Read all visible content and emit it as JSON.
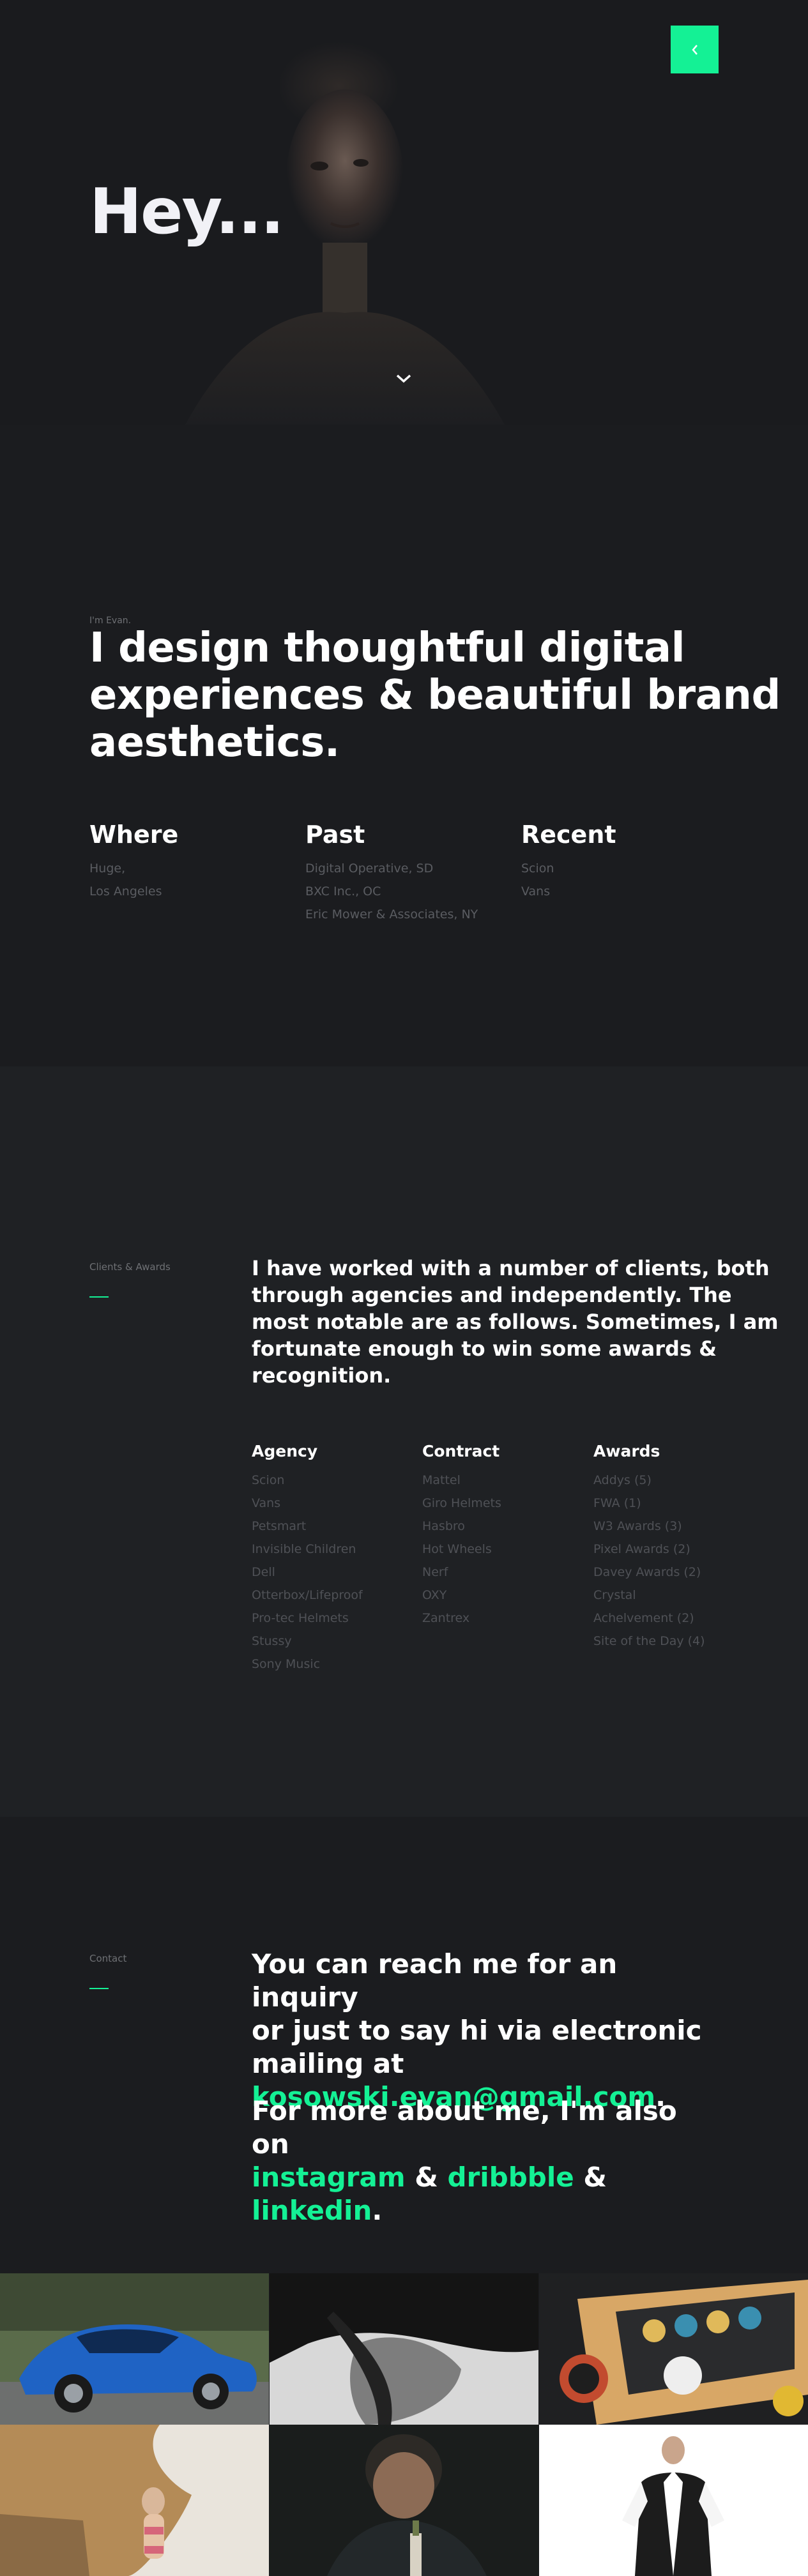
{
  "hero": {
    "title": "Hey..."
  },
  "about": {
    "eyebrow": "I'm Evan.",
    "headline_lines": [
      "I design thoughtful digital",
      "experiences & beautiful brand",
      "aesthetics."
    ],
    "where": {
      "heading": "Where",
      "items": [
        "Huge,",
        "Los Angeles"
      ]
    },
    "past": {
      "heading": "Past",
      "items": [
        "Digital Operative, SD",
        "BXC Inc., OC",
        "Eric Mower & Associates, NY"
      ]
    },
    "recent": {
      "heading": "Recent",
      "items": [
        "Scion",
        "Vans"
      ]
    }
  },
  "clients": {
    "label": "Clients & Awards",
    "paragraph_lines": [
      "I have worked with a number of clients, both",
      "through agencies and independently. The",
      "most notable are as follows. Sometimes, I am",
      "fortunate enough to win some awards &",
      "recognition."
    ],
    "agency": {
      "heading": "Agency",
      "items": [
        "Scion",
        "Vans",
        "Petsmart",
        "Invisible Children",
        "Dell",
        "Otterbox/Lifeproof",
        "Pro-tec Helmets",
        "Stussy",
        "Sony Music"
      ]
    },
    "contract": {
      "heading": "Contract",
      "items": [
        "Mattel",
        "Giro Helmets",
        "Hasbro",
        "Hot Wheels",
        "Nerf",
        "OXY",
        "Zantrex"
      ]
    },
    "awards": {
      "heading": "Awards",
      "items": [
        "Addys (5)",
        "FWA (1)",
        "W3 Awards (3)",
        "Pixel Awards (2)",
        "Davey Awards (2)",
        "Crystal",
        "Achelvement (2)",
        "Site of the Day (4)"
      ]
    }
  },
  "contact": {
    "label": "Contact",
    "line1": "You can reach me for an inquiry",
    "line2": "or just to say hi via electronic",
    "line3": "mailing at",
    "email": "kosowski.evan@gmail.com",
    "period": ".",
    "more_line": "For more about me, I'm also on",
    "instagram": "instagram",
    "amp": "&",
    "dribbble": "dribbble",
    "linkedin": "linkedin"
  },
  "colors": {
    "accent": "#14f195",
    "background": "#1b1c1f",
    "muted_text": "#5a5c61"
  },
  "icons": {
    "back": "chevron-left-icon",
    "scroll": "chevron-down-icon"
  }
}
